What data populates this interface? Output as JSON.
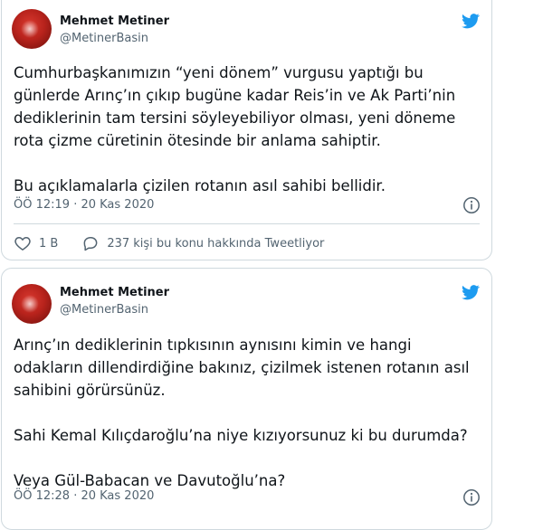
{
  "colors": {
    "twitter_blue": "#1d9bf0",
    "text": "#0f1419",
    "secondary": "#536471",
    "border": "#cfd9de"
  },
  "tweets": [
    {
      "name": "Mehmet Metiner",
      "handle": "@MetinerBasin",
      "lines": [
        "Cumhurbaşkanımızın “yeni dönem” vurgusu yaptığı bu",
        "günlerde Arınç’ın çıkıp bugüne kadar Reis’in ve Ak Parti’nin",
        "dediklerinin tam tersini söyleyebiliyor olması, yeni döneme",
        "rota çizme cüretinin ötesinde bir anlama sahiptir.",
        "",
        "Bu açıklamalarla çizilen rotanın asıl sahibi bellidir."
      ],
      "time": "ÖÖ 12:19 · 20 Kas 2020",
      "likes": "1 B",
      "reply_text": "237 kişi bu konu hakkında Tweetliyor",
      "icons": [
        "twitter-bird-icon",
        "info-icon",
        "heart-icon",
        "speech-bubble-icon"
      ]
    },
    {
      "name": "Mehmet Metiner",
      "handle": "@MetinerBasin",
      "lines": [
        "Arınç’ın dediklerinin tıpkısının aynısını kimin ve hangi",
        "odakların dillendirdiğine bakınız, çizilmek istenen rotanın asıl",
        "sahibini görürsünüz.",
        "",
        "Sahi Kemal Kılıçdaroğlu’na niye kızıyorsunuz ki bu durumda?",
        "",
        "Veya Gül-Babacan ve Davutoğlu’na?"
      ],
      "time": "ÖÖ 12:28 · 20 Kas 2020",
      "icons": [
        "twitter-bird-icon",
        "info-icon"
      ]
    }
  ]
}
